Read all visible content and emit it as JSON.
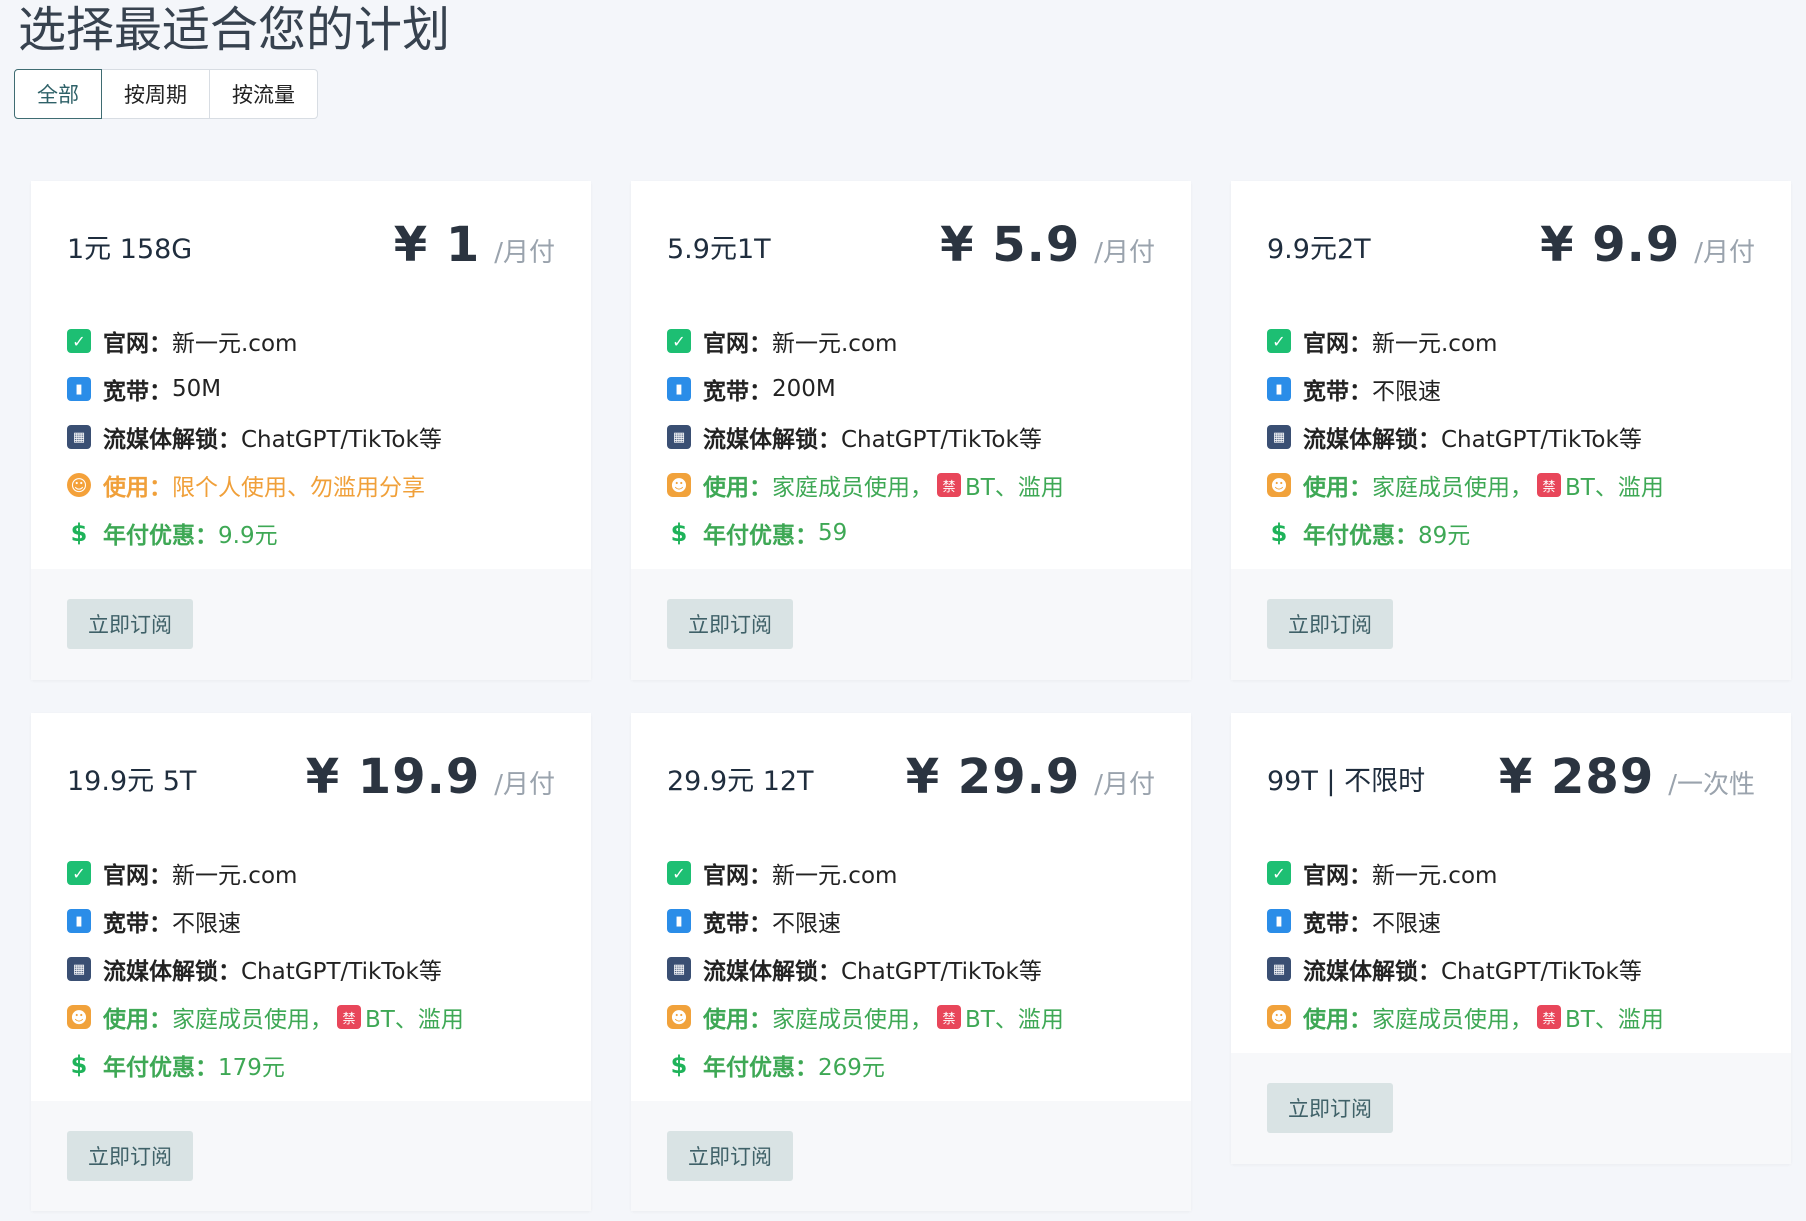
{
  "page": {
    "title": "选择最适合您的计划"
  },
  "tabs": [
    {
      "label": "全部",
      "active": true
    },
    {
      "label": "按周期",
      "active": false
    },
    {
      "label": "按流量",
      "active": false
    }
  ],
  "subscribe_label": "立即订阅",
  "plans": [
    {
      "name": "1元 158G",
      "price": "¥ 1",
      "period": "/月付",
      "features": [
        {
          "icon": "check-icon",
          "label": "官网：",
          "value": "新一元.com",
          "style": "normal"
        },
        {
          "icon": "signal-icon",
          "label": "宽带：",
          "value": "50M",
          "style": "normal"
        },
        {
          "icon": "film-icon",
          "label": "流媒体解锁：",
          "value": "ChatGPT/TikTok等",
          "style": "normal"
        },
        {
          "icon": "person-icon",
          "label": "使用：",
          "value": "限个人使用、勿滥用分享",
          "style": "orange"
        },
        {
          "icon": "dollar-icon",
          "label": "年付优惠：",
          "value": "9.9元",
          "style": "green"
        }
      ]
    },
    {
      "name": "5.9元1T",
      "price": "¥ 5.9",
      "period": "/月付",
      "features": [
        {
          "icon": "check-icon",
          "label": "官网：",
          "value": "新一元.com",
          "style": "normal"
        },
        {
          "icon": "signal-icon",
          "label": "宽带：",
          "value": "200M",
          "style": "normal"
        },
        {
          "icon": "film-icon",
          "label": "流媒体解锁：",
          "value": "ChatGPT/TikTok等",
          "style": "normal"
        },
        {
          "icon": "family-icon",
          "label": "使用：",
          "value": "家庭成员使用，",
          "suffix": "BT、滥用",
          "style": "green"
        },
        {
          "icon": "dollar-icon",
          "label": "年付优惠：",
          "value": "59",
          "style": "green"
        }
      ]
    },
    {
      "name": "9.9元2T",
      "price": "¥ 9.9",
      "period": "/月付",
      "features": [
        {
          "icon": "check-icon",
          "label": "官网：",
          "value": "新一元.com",
          "style": "normal"
        },
        {
          "icon": "signal-icon",
          "label": "宽带：",
          "value": "不限速",
          "style": "normal"
        },
        {
          "icon": "film-icon",
          "label": "流媒体解锁：",
          "value": "ChatGPT/TikTok等",
          "style": "normal"
        },
        {
          "icon": "family-icon",
          "label": "使用：",
          "value": "家庭成员使用，",
          "suffix": "BT、滥用",
          "style": "green"
        },
        {
          "icon": "dollar-icon",
          "label": "年付优惠：",
          "value": "89元",
          "style": "green"
        }
      ]
    },
    {
      "name": "19.9元 5T",
      "price": "¥ 19.9",
      "period": "/月付",
      "features": [
        {
          "icon": "check-icon",
          "label": "官网：",
          "value": "新一元.com",
          "style": "normal"
        },
        {
          "icon": "signal-icon",
          "label": "宽带：",
          "value": "不限速",
          "style": "normal"
        },
        {
          "icon": "film-icon",
          "label": "流媒体解锁：",
          "value": "ChatGPT/TikTok等",
          "style": "normal"
        },
        {
          "icon": "family-icon",
          "label": "使用：",
          "value": "家庭成员使用，",
          "suffix": "BT、滥用",
          "style": "green"
        },
        {
          "icon": "dollar-icon",
          "label": "年付优惠：",
          "value": "179元",
          "style": "green"
        }
      ]
    },
    {
      "name": "29.9元 12T",
      "price": "¥ 29.9",
      "period": "/月付",
      "features": [
        {
          "icon": "check-icon",
          "label": "官网：",
          "value": "新一元.com",
          "style": "normal"
        },
        {
          "icon": "signal-icon",
          "label": "宽带：",
          "value": "不限速",
          "style": "normal"
        },
        {
          "icon": "film-icon",
          "label": "流媒体解锁：",
          "value": "ChatGPT/TikTok等",
          "style": "normal"
        },
        {
          "icon": "family-icon",
          "label": "使用：",
          "value": "家庭成员使用，",
          "suffix": "BT、滥用",
          "style": "green"
        },
        {
          "icon": "dollar-icon",
          "label": "年付优惠：",
          "value": "269元",
          "style": "green"
        }
      ]
    },
    {
      "name": "99T | 不限时",
      "price": "¥ 289",
      "period": "/一次性",
      "features": [
        {
          "icon": "check-icon",
          "label": "官网：",
          "value": "新一元.com",
          "style": "normal"
        },
        {
          "icon": "signal-icon",
          "label": "宽带：",
          "value": "不限速",
          "style": "normal"
        },
        {
          "icon": "film-icon",
          "label": "流媒体解锁：",
          "value": "ChatGPT/TikTok等",
          "style": "normal"
        },
        {
          "icon": "family-icon",
          "label": "使用：",
          "value": "家庭成员使用，",
          "suffix": "BT、滥用",
          "style": "green"
        }
      ]
    }
  ]
}
